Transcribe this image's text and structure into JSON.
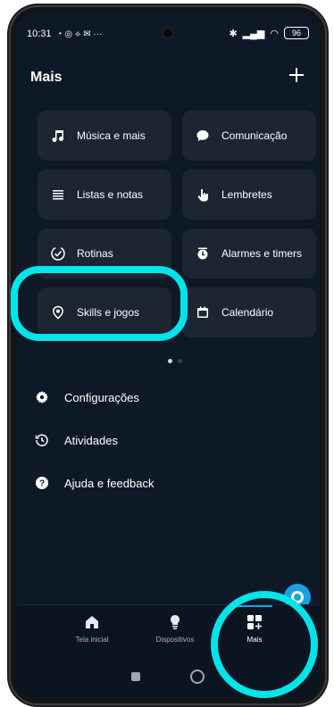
{
  "status": {
    "time": "10:31",
    "battery": "96"
  },
  "header": {
    "title": "Mais"
  },
  "tiles": [
    {
      "label": "Música e mais",
      "icon": "music-note-icon"
    },
    {
      "label": "Comunicação",
      "icon": "chat-bubble-icon"
    },
    {
      "label": "Listas e notas",
      "icon": "list-icon"
    },
    {
      "label": "Lembretes",
      "icon": "hand-pointer-icon"
    },
    {
      "label": "Rotinas",
      "icon": "routine-check-icon"
    },
    {
      "label": "Alarmes e timers",
      "icon": "alarm-clock-icon"
    },
    {
      "label": "Skills e jogos",
      "icon": "location-pin-icon"
    },
    {
      "label": "Calendário",
      "icon": "calendar-icon"
    }
  ],
  "menu": [
    {
      "label": "Configurações",
      "icon": "gear-icon"
    },
    {
      "label": "Atividades",
      "icon": "history-icon"
    },
    {
      "label": "Ajuda e feedback",
      "icon": "help-icon"
    }
  ],
  "nav": {
    "home": "Tela inicial",
    "devices": "Dispositivos",
    "more": "Mais"
  },
  "colors": {
    "accent": "#19a2e7",
    "highlight": "#00e4ea",
    "background": "#0e1927",
    "tile": "#1c2532"
  }
}
